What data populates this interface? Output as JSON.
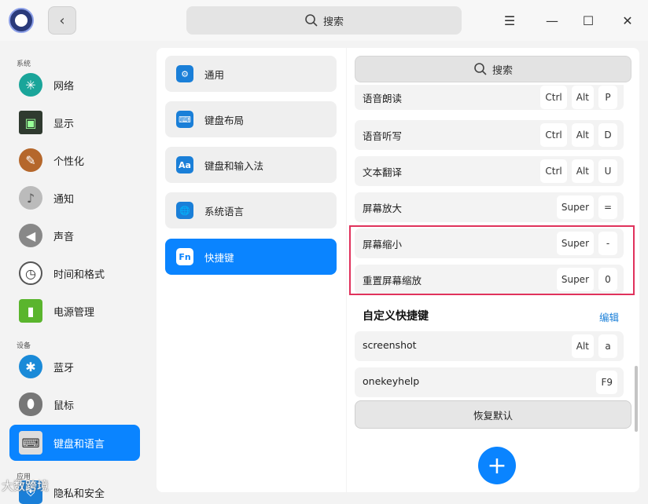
{
  "header": {
    "search_placeholder": "搜索",
    "back": "‹",
    "menu": "☰",
    "minimize": "—",
    "maximize": "☐",
    "close": "✕"
  },
  "sidebar": {
    "section_system": "系统",
    "section_device": "设备",
    "section_app": "应用",
    "items": [
      {
        "label": "网络"
      },
      {
        "label": "显示"
      },
      {
        "label": "个性化"
      },
      {
        "label": "通知"
      },
      {
        "label": "声音"
      },
      {
        "label": "时间和格式"
      },
      {
        "label": "电源管理"
      },
      {
        "label": "蓝牙"
      },
      {
        "label": "鼠标"
      },
      {
        "label": "键盘和语言"
      },
      {
        "label": "隐私和安全"
      }
    ]
  },
  "keyboard_menu": {
    "items": [
      {
        "label": "通用",
        "icon": "⚙"
      },
      {
        "label": "键盘布局",
        "icon": "⌨"
      },
      {
        "label": "键盘和输入法",
        "icon": "Aa"
      },
      {
        "label": "系统语言",
        "icon": "🌐"
      },
      {
        "label": "快捷键",
        "icon": "Fn"
      }
    ]
  },
  "shortcuts": {
    "search_placeholder": "搜索",
    "rows": [
      {
        "label": "语音朗读",
        "keys": [
          "Ctrl",
          "Alt",
          "P"
        ]
      },
      {
        "label": "语音听写",
        "keys": [
          "Ctrl",
          "Alt",
          "D"
        ]
      },
      {
        "label": "文本翻译",
        "keys": [
          "Ctrl",
          "Alt",
          "U"
        ]
      },
      {
        "label": "屏幕放大",
        "keys": [
          "Super",
          "="
        ]
      },
      {
        "label": "屏幕缩小",
        "keys": [
          "Super",
          "-"
        ]
      },
      {
        "label": "重置屏幕缩放",
        "keys": [
          "Super",
          "0"
        ]
      }
    ],
    "custom_title": "自定义快捷键",
    "edit": "编辑",
    "custom_rows": [
      {
        "label": "screenshot",
        "keys": [
          "Alt",
          "a"
        ]
      },
      {
        "label": "onekeyhelp",
        "keys": [
          "F9"
        ]
      }
    ],
    "restore_default": "恢复默认",
    "add": "+"
  },
  "watermark": "大数跨境"
}
